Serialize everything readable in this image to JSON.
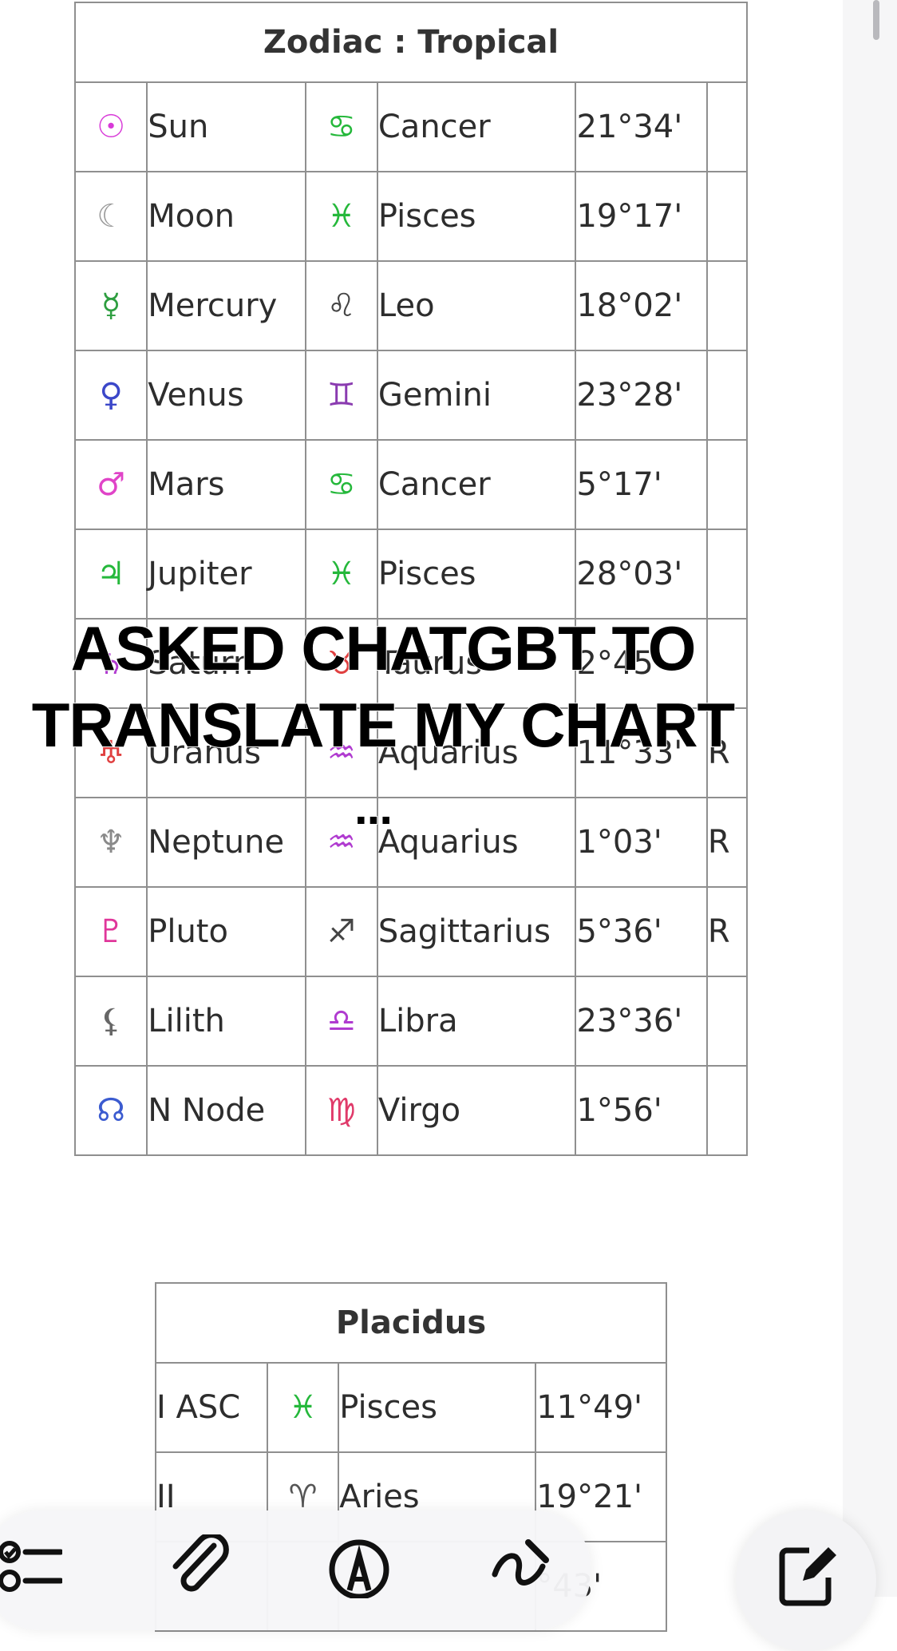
{
  "zodiac": {
    "title": "Zodiac : Tropical",
    "rows": [
      {
        "planet_symbol": "☉",
        "planet": "Sun",
        "sign_symbol": "♋",
        "sign": "Cancer",
        "degree": "21°34'",
        "retro": "",
        "planet_color": "#d83ad8",
        "sign_color": "#25b83b"
      },
      {
        "planet_symbol": "☾",
        "planet": "Moon",
        "sign_symbol": "♓",
        "sign": "Pisces",
        "degree": "19°17'",
        "retro": "",
        "planet_color": "#9a9a9a",
        "sign_color": "#25b83b"
      },
      {
        "planet_symbol": "☿",
        "planet": "Mercury",
        "sign_symbol": "♌",
        "sign": "Leo",
        "degree": "18°02'",
        "retro": "",
        "planet_color": "#2e9e40",
        "sign_color": "#444444"
      },
      {
        "planet_symbol": "♀",
        "planet": "Venus",
        "sign_symbol": "♊",
        "sign": "Gemini",
        "degree": "23°28'",
        "retro": "",
        "planet_color": "#3b47c9",
        "sign_color": "#8a3bb0"
      },
      {
        "planet_symbol": "♂",
        "planet": "Mars",
        "sign_symbol": "♋",
        "sign": "Cancer",
        "degree": "5°17'",
        "retro": "",
        "planet_color": "#e044c8",
        "sign_color": "#25b83b"
      },
      {
        "planet_symbol": "♃",
        "planet": "Jupiter",
        "sign_symbol": "♓",
        "sign": "Pisces",
        "degree": "28°03'",
        "retro": "",
        "planet_color": "#25b83b",
        "sign_color": "#25b83b"
      },
      {
        "planet_symbol": "♄",
        "planet": "Saturn",
        "sign_symbol": "♉",
        "sign": "Taurus",
        "degree": "2°45'",
        "retro": "",
        "planet_color": "#b03bd0",
        "sign_color": "#e04040"
      },
      {
        "planet_symbol": "♅",
        "planet": "Uranus",
        "sign_symbol": "♒",
        "sign": "Aquarius",
        "degree": "11°33'",
        "retro": "R",
        "planet_color": "#e04040",
        "sign_color": "#b03bd0"
      },
      {
        "planet_symbol": "♆",
        "planet": "Neptune",
        "sign_symbol": "♒",
        "sign": "Aquarius",
        "degree": "1°03'",
        "retro": "R",
        "planet_color": "#8a8a8a",
        "sign_color": "#b03bd0"
      },
      {
        "planet_symbol": "♇",
        "planet": "Pluto",
        "sign_symbol": "♐",
        "sign": "Sagittarius",
        "degree": "5°36'",
        "retro": "R",
        "planet_color": "#e0369a",
        "sign_color": "#444444"
      },
      {
        "planet_symbol": "⚸",
        "planet": "Lilith",
        "sign_symbol": "♎",
        "sign": "Libra",
        "degree": "23°36'",
        "retro": "",
        "planet_color": "#666666",
        "sign_color": "#b03bd0"
      },
      {
        "planet_symbol": "☊",
        "planet": "N Node",
        "sign_symbol": "♍",
        "sign": "Virgo",
        "degree": "1°56'",
        "retro": "",
        "planet_color": "#3b5bd0",
        "sign_color": "#e03a6a"
      }
    ]
  },
  "placidus": {
    "title": "Placidus",
    "rows": [
      {
        "house": "I ASC",
        "sign_symbol": "♓",
        "sign": "Pisces",
        "degree": "11°49'",
        "sign_color": "#25b83b"
      },
      {
        "house": "II",
        "sign_symbol": "♈",
        "sign": "Aries",
        "degree": "19°21'",
        "sign_color": "#555555"
      },
      {
        "house": "",
        "sign_symbol": "",
        "sign": "",
        "degree": "°43'",
        "sign_color": "#555555"
      }
    ]
  },
  "overlay": {
    "line1": "ASKED CHATGBT TO",
    "line2": "TRANSLATE MY CHART",
    "line3": "..."
  },
  "toolbar": {
    "icons": [
      "checklist-icon",
      "paperclip-icon",
      "markup-pen-icon",
      "draw-icon"
    ],
    "compose_icon": "compose-icon"
  }
}
